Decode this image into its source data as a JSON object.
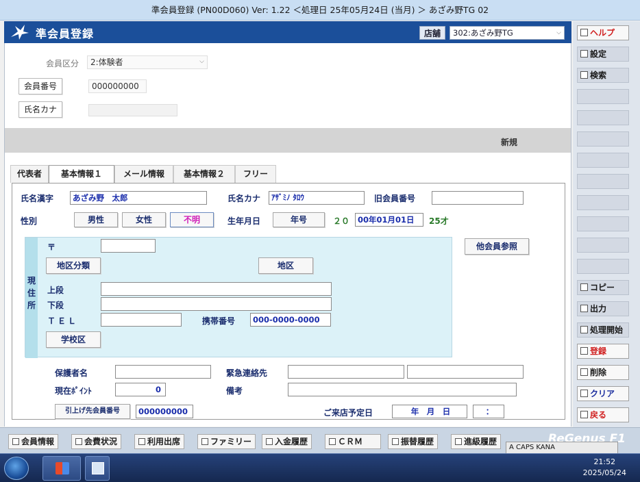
{
  "window": {
    "title": "準会員登録 (PN00D060) Ver: 1.22 ＜処理日 25年05月24日 (当月) ＞ あざみ野TG 02"
  },
  "header": {
    "app_name": "準会員登録",
    "store_label": "店舗",
    "store_value": "302:あざみ野TG"
  },
  "top_fields": {
    "member_type_label": "会員区分",
    "member_type_value": "2:体験者",
    "member_no_label": "会員番号",
    "member_no_value": "000000000",
    "kana_name_label": "氏名カナ",
    "kana_name_value": ""
  },
  "status_band": {
    "text": "新規"
  },
  "tabs": [
    "代表者",
    "基本情報１",
    "メール情報",
    "基本情報２",
    "フリー"
  ],
  "form": {
    "name_kanji_label": "氏名漢字",
    "name_kanji_value": "あざみ野　太郎",
    "name_kana_label": "氏名カナ",
    "name_kana_value": "ｱｻﾞﾐﾉ ﾀﾛｳ",
    "old_member_label": "旧会員番号",
    "old_member_value": "",
    "gender_label": "性別",
    "gender_male": "男性",
    "gender_female": "女性",
    "gender_unknown": "不明",
    "birth_label": "生年月日",
    "era_button": "年号",
    "birth_prefix": "２０",
    "birth_value": "00年01月01日",
    "age": "25才",
    "postal_label": "〒",
    "postal_value": "",
    "district_cat_button": "地区分類",
    "district_button": "地区",
    "address_side": "現\n住\n所",
    "upper_label": "上段",
    "upper_value": "",
    "lower_label": "下段",
    "lower_value": "",
    "tel_label": "ＴＥＬ",
    "tel_value": "",
    "mobile_label": "携帯番号",
    "mobile_value": "000-0000-0000",
    "school_button": "学校区",
    "other_member_button": "他会員参照",
    "guardian_label": "保護者名",
    "guardian_value": "",
    "emergency_label": "緊急連絡先",
    "emergency_value_1": "",
    "emergency_value_2": "",
    "points_label": "現在ﾎﾟｲﾝﾄ",
    "points_value": "0",
    "notes_label": "備考",
    "notes_value": "",
    "transfer_button": "引上げ先会員番号",
    "transfer_value": "000000000",
    "visit_label": "ご来店予定日",
    "visit_date": "年　月　日",
    "visit_time": "："
  },
  "sidebar": {
    "help": "ヘルプ",
    "settings": "設定",
    "search": "検索",
    "copy": "コピー",
    "output": "出力",
    "process_start": "処理開始",
    "register": "登録",
    "delete": "削除",
    "clear": "クリア",
    "back": "戻る"
  },
  "bottom_buttons": [
    "会員情報",
    "会費状況",
    "利用出席",
    "ファミリー",
    "入金履歴",
    "ＣＲＭ",
    "振替履歴",
    "進級履歴"
  ],
  "brand": "ReGenus F1",
  "ime": {
    "text": "A CAPS KANA"
  },
  "taskbar": {
    "time": "21:52",
    "date": "2025/05/24"
  }
}
